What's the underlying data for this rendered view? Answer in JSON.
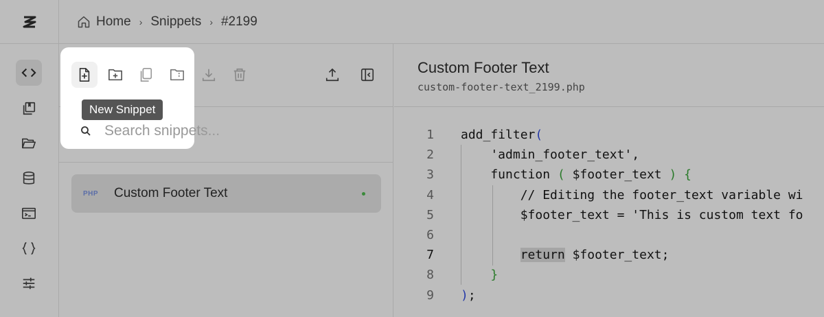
{
  "breadcrumb": {
    "home": "Home",
    "section": "Snippets",
    "current": "#2199"
  },
  "toolbar": {
    "tooltip": "New Snippet"
  },
  "search": {
    "placeholder": "Search snippets..."
  },
  "snippets": [
    {
      "lang": "PHP",
      "name": "Custom Footer Text",
      "status_color": "#3a8a3a"
    }
  ],
  "editor": {
    "title": "Custom Footer Text",
    "filename": "custom-footer-text_2199.php",
    "current_line": 7,
    "lines": [
      {
        "num": "1",
        "text": "add_filter("
      },
      {
        "num": "2",
        "text": "    'admin_footer_text',"
      },
      {
        "num": "3",
        "text": "    function ( $footer_text ) {"
      },
      {
        "num": "4",
        "text": "        // Editing the footer_text variable wi"
      },
      {
        "num": "5",
        "text": "        $footer_text = 'This is custom text fo"
      },
      {
        "num": "6",
        "text": ""
      },
      {
        "num": "7",
        "text": "        return $footer_text;"
      },
      {
        "num": "8",
        "text": "    }"
      },
      {
        "num": "9",
        "text": ");"
      }
    ]
  },
  "icons": {
    "rail": [
      "logo-icon",
      "code-icon",
      "library-icon",
      "folder-icon",
      "database-icon",
      "terminal-icon",
      "braces-icon",
      "sliders-icon"
    ],
    "toolbar": [
      "new-snippet-icon",
      "new-folder-icon",
      "duplicate-icon",
      "folder-move-icon",
      "download-icon",
      "trash-icon",
      "upload-icon",
      "panel-toggle-icon"
    ]
  }
}
